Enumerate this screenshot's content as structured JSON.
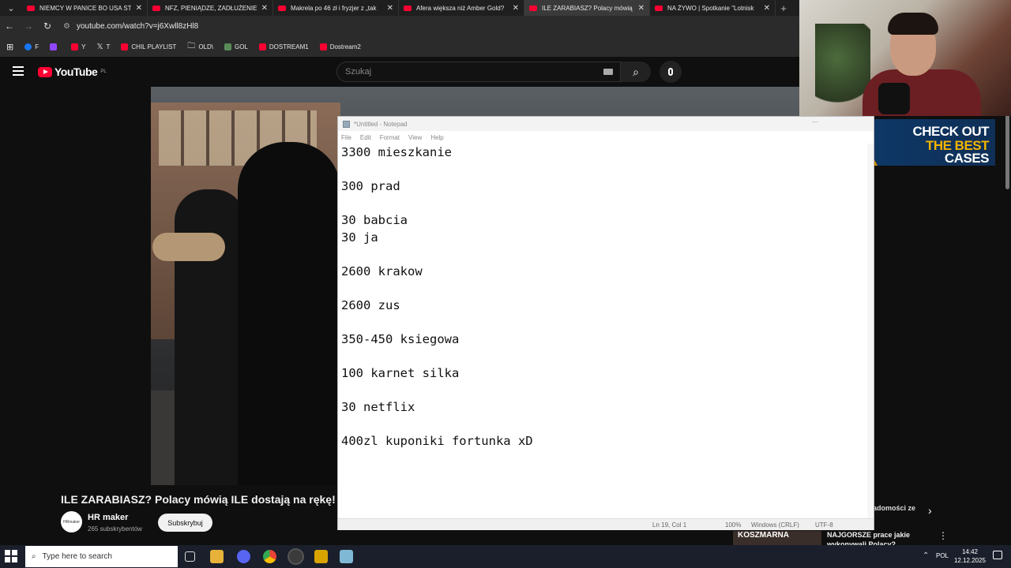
{
  "browser": {
    "tabs": [
      {
        "label": "NIEMCY W PANICE BO USA STA",
        "active": false
      },
      {
        "label": "NFZ, PIENIĄDZE, ZADŁUŻENIE :",
        "active": false
      },
      {
        "label": "Makrela po 46 zł i fryzjer z „tak",
        "active": false
      },
      {
        "label": "Afera większa niż Amber Gold?",
        "active": false
      },
      {
        "label": "ILE ZARABIASZ? Polacy mówią",
        "active": true
      },
      {
        "label": "NA ŻYWO | Spotkanie \"Lotnisk",
        "active": false
      }
    ],
    "tab_close": "✕",
    "tab_add": "+",
    "url": "youtube.com/watch?v=j6Xwll8zHl8",
    "bookmarks": [
      {
        "label": "F",
        "color": "#1877f2"
      },
      {
        "label": "",
        "color": "#9146ff"
      },
      {
        "label": "Y",
        "color": "#ff0033"
      },
      {
        "label": "T",
        "color": "#ffffff"
      },
      {
        "label": "CHIL PLAYLIST",
        "color": "#ff0033"
      },
      {
        "label": "OLD\\",
        "color": "#cccccc"
      },
      {
        "label": "GOL",
        "color": "#5a8c5a"
      },
      {
        "label": "DOSTREAM1",
        "color": "#ff0033"
      },
      {
        "label": "Dostream2",
        "color": "#ff0033"
      }
    ]
  },
  "youtube": {
    "logo_text": "YouTube",
    "region": "PL",
    "search_placeholder": "Szukaj",
    "video_title": "ILE ZARABIASZ? Polacy mówią ILE dostają na rękę!",
    "channel": {
      "name": "HR maker",
      "subs": "265 subskrybentów",
      "avatar_text": "HRmaker"
    },
    "subscribe_label": "Subskrybuj",
    "suggestion_chip": "adomości ze",
    "suggestion_thumb": "KOSZMARNA",
    "suggestion_title": "NAJGORSZE prace jakie wykonywali Polacy?"
  },
  "ad": {
    "line1": "CHECK OUT",
    "line2": "THE BEST",
    "line3": "CASES",
    "accent": "#f5b400"
  },
  "notepad": {
    "title": "*Untitled - Notepad",
    "menu": [
      "File",
      "Edit",
      "Format",
      "View",
      "Help"
    ],
    "content": "3300 mieszkanie\n\n300 prad\n\n30 babcia\n30 ja\n\n2600 krakow\n\n2600 zus\n\n350-450 ksiegowa\n\n100 karnet silka\n\n30 netflix\n\n400zl kuponiki fortunka xD",
    "status": {
      "position": "Ln 19, Col 1",
      "zoom": "100%",
      "eol": "Windows (CRLF)",
      "encoding": "UTF-8"
    }
  },
  "taskbar": {
    "search_placeholder": "Type here to search",
    "lang": "POL",
    "time": "14:42",
    "date": "12.12.2025"
  }
}
